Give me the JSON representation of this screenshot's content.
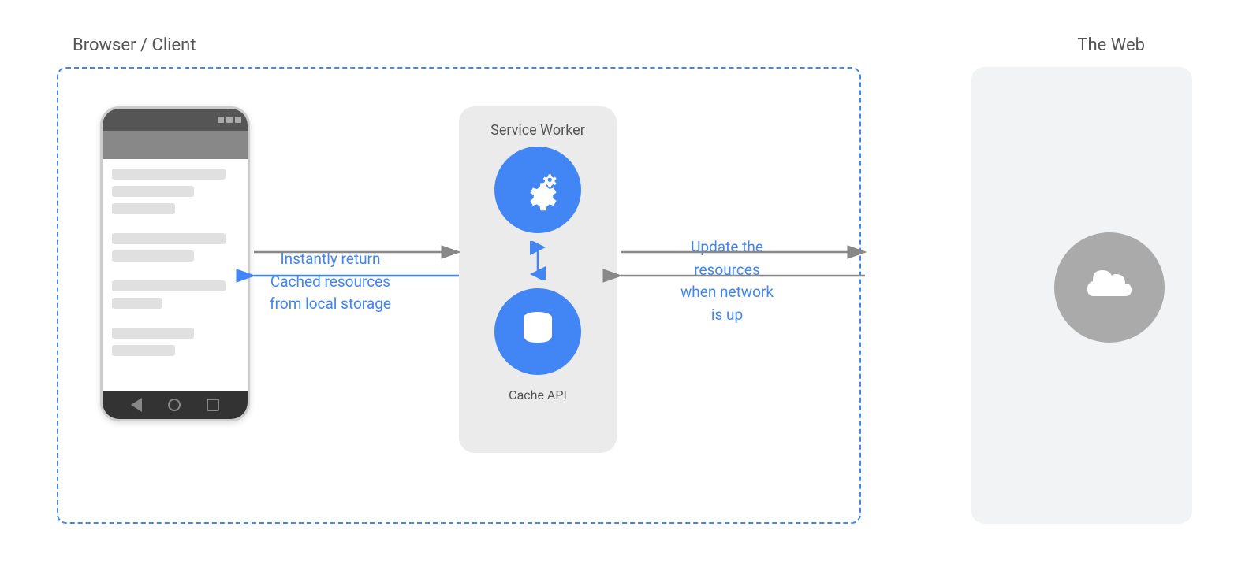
{
  "diagram": {
    "browser_client_label": "Browser / Client",
    "the_web_label": "The Web",
    "service_worker_label": "Service Worker",
    "cache_api_label": "Cache API",
    "instantly_return_line1": "Instantly return",
    "instantly_return_line2": "Cached resources",
    "instantly_return_line3": "from local storage",
    "update_the_line1": "Update the",
    "update_the_line2": "resources",
    "update_the_line3": "when network",
    "update_the_line4": "is up",
    "colors": {
      "blue": "#4285f4",
      "dashed_border": "#4285f4",
      "label_text": "#555555",
      "bg_light": "#f1f3f4",
      "sw_box_bg": "#ebebeb",
      "cloud_circle": "#aaaaaa"
    }
  }
}
